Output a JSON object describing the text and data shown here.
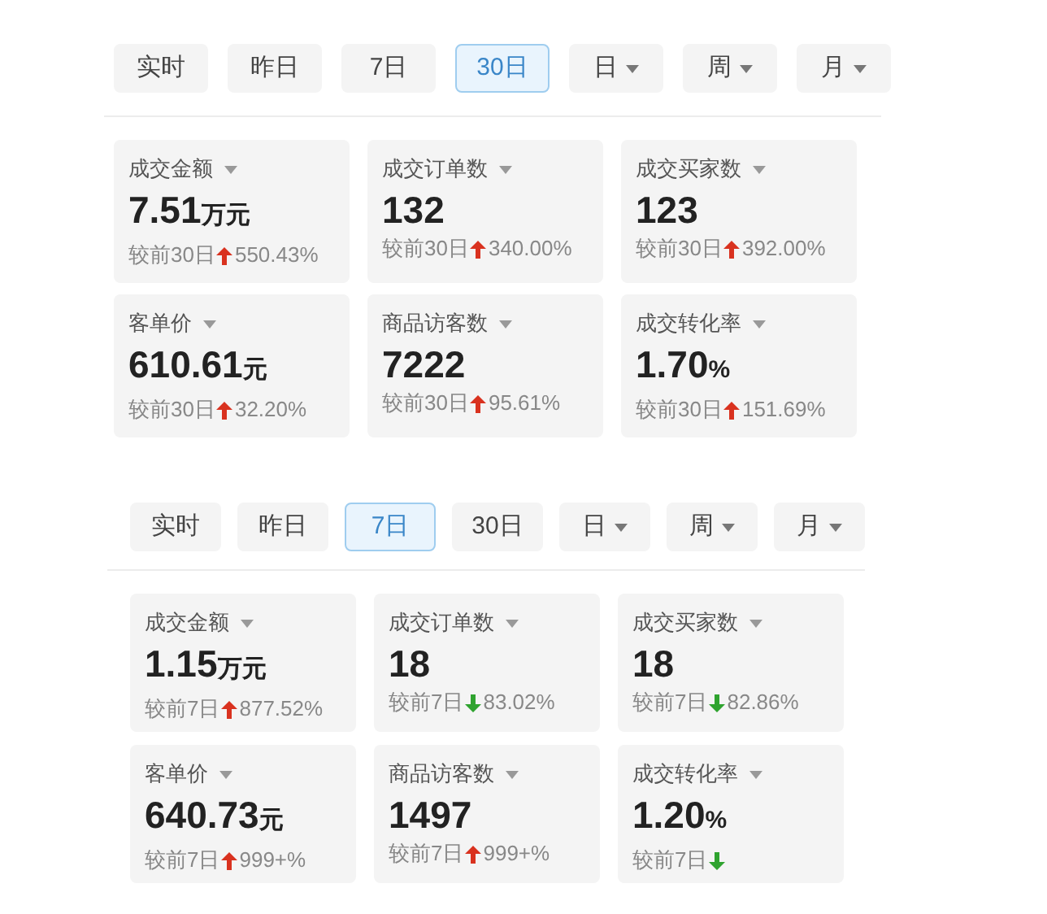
{
  "panels": [
    {
      "tabs": [
        {
          "label": "实时",
          "selected": false,
          "dropdown": false
        },
        {
          "label": "昨日",
          "selected": false,
          "dropdown": false
        },
        {
          "label": "7日",
          "selected": false,
          "dropdown": false
        },
        {
          "label": "30日",
          "selected": true,
          "dropdown": false
        },
        {
          "label": "日",
          "selected": false,
          "dropdown": true
        },
        {
          "label": "周",
          "selected": false,
          "dropdown": true
        },
        {
          "label": "月",
          "selected": false,
          "dropdown": true
        }
      ],
      "cards": [
        {
          "title": "成交金额",
          "value": "7.51",
          "unit": "万元",
          "compare": "较前30日",
          "rising": true,
          "change": "550.43%"
        },
        {
          "title": "成交订单数",
          "value": "132",
          "compare": "较前30日",
          "rising": true,
          "change": "340.00%"
        },
        {
          "title": "成交买家数",
          "value": "123",
          "compare": "较前30日",
          "rising": true,
          "change": "392.00%"
        },
        {
          "title": "客单价",
          "value": "610.61",
          "unit": "元",
          "compare": "较前30日",
          "rising": true,
          "change": "32.20%"
        },
        {
          "title": "商品访客数",
          "value": "7222",
          "compare": "较前30日",
          "rising": true,
          "change": "95.61%"
        },
        {
          "title": "成交转化率",
          "value": "1.70",
          "unit": "%",
          "compare": "较前30日",
          "rising": true,
          "change": "151.69%"
        }
      ]
    },
    {
      "tabs": [
        {
          "label": "实时",
          "selected": false,
          "dropdown": false
        },
        {
          "label": "昨日",
          "selected": false,
          "dropdown": false
        },
        {
          "label": "7日",
          "selected": true,
          "dropdown": false
        },
        {
          "label": "30日",
          "selected": false,
          "dropdown": false
        },
        {
          "label": "日",
          "selected": false,
          "dropdown": true
        },
        {
          "label": "周",
          "selected": false,
          "dropdown": true
        },
        {
          "label": "月",
          "selected": false,
          "dropdown": true
        }
      ],
      "cards": [
        {
          "title": "成交金额",
          "value": "1.15",
          "unit": "万元",
          "compare": "较前7日",
          "rising": true,
          "change": "877.52%"
        },
        {
          "title": "成交订单数",
          "value": "18",
          "compare": "较前7日",
          "rising": false,
          "change": "83.02%"
        },
        {
          "title": "成交买家数",
          "value": "18",
          "compare": "较前7日",
          "rising": false,
          "change": "82.86%"
        },
        {
          "title": "客单价",
          "value": "640.73",
          "unit": "元",
          "compare": "较前7日",
          "rising": true,
          "change": "999+%"
        },
        {
          "title": "商品访客数",
          "value": "1497",
          "compare": "较前7日",
          "rising": true,
          "change": "999+%"
        },
        {
          "title": "成交转化率",
          "value": "1.20",
          "unit": "%",
          "compare": "较前7日",
          "rising": false
        }
      ]
    }
  ]
}
